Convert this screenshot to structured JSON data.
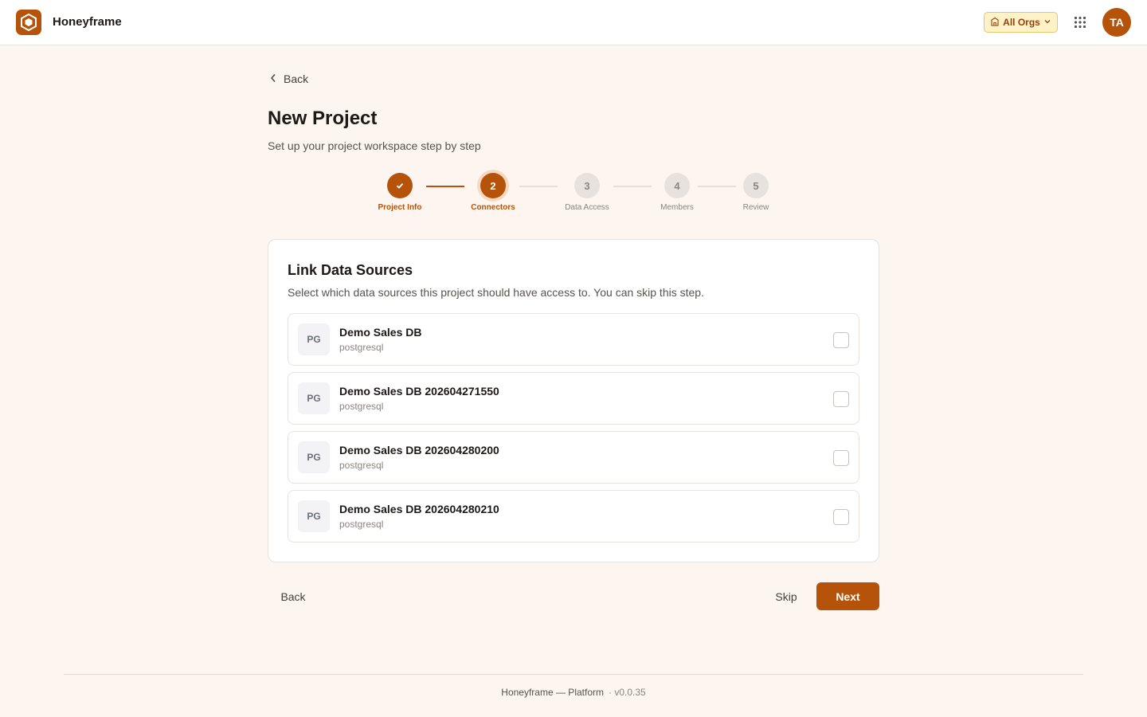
{
  "header": {
    "app_name": "Honeyframe",
    "org_selector_label": "All Orgs",
    "avatar_initials": "TA",
    "icons": [
      "building-icon",
      "chevron-down-icon",
      "apps-grid-icon"
    ]
  },
  "nav": {
    "back_label": "Back"
  },
  "page": {
    "title": "New Project",
    "subtitle": "Set up your project workspace step by step"
  },
  "stepper": {
    "steps": [
      {
        "number": "1",
        "label": "Project Info",
        "state": "done"
      },
      {
        "number": "2",
        "label": "Connectors",
        "state": "active"
      },
      {
        "number": "3",
        "label": "Data Access",
        "state": "todo"
      },
      {
        "number": "4",
        "label": "Members",
        "state": "todo"
      },
      {
        "number": "5",
        "label": "Review",
        "state": "todo"
      }
    ]
  },
  "card": {
    "title": "Link Data Sources",
    "description": "Select which data sources this project should have access to. You can skip this step.",
    "sources": [
      {
        "badge": "PG",
        "name": "Demo Sales DB",
        "type": "postgresql",
        "checked": false
      },
      {
        "badge": "PG",
        "name": "Demo Sales DB 202604271550",
        "type": "postgresql",
        "checked": false
      },
      {
        "badge": "PG",
        "name": "Demo Sales DB 202604280200",
        "type": "postgresql",
        "checked": false
      },
      {
        "badge": "PG",
        "name": "Demo Sales DB 202604280210",
        "type": "postgresql",
        "checked": false
      }
    ]
  },
  "actions": {
    "back_label": "Back",
    "skip_label": "Skip",
    "next_label": "Next"
  },
  "footer": {
    "text": "Honeyframe — Platform",
    "version": "· v0.0.35"
  },
  "colors": {
    "accent": "#b45309",
    "background": "#fdf6f0",
    "org_badge_bg": "#fef3c7"
  }
}
